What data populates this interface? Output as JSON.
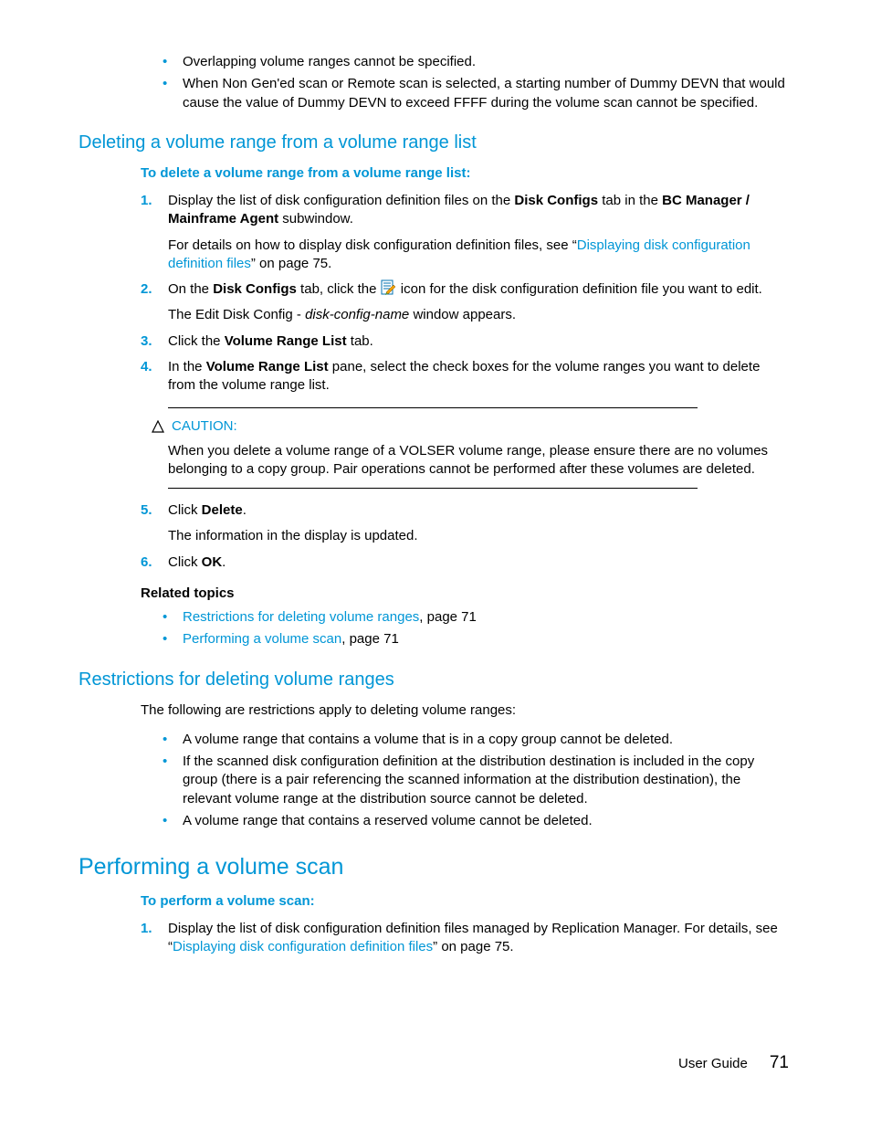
{
  "intro_bullets": [
    "Overlapping volume ranges cannot be specified.",
    "When Non Gen'ed scan or Remote scan is selected, a starting number of Dummy DEVN that would cause the value of Dummy DEVN to exceed FFFF during the volume scan cannot be specified."
  ],
  "sec1": {
    "title": "Deleting a volume range from a volume range list",
    "proc_head": "To delete a volume range from a volume range list:",
    "step1_a": "Display the list of disk configuration definition files on the ",
    "step1_b": "Disk Configs",
    "step1_c": " tab in the ",
    "step1_d": "BC Manager / Mainframe Agent",
    "step1_e": " subwindow.",
    "step1_p2a": "For details on how to display disk configuration definition files, see “",
    "step1_link": "Displaying disk configuration definition files",
    "step1_p2b": "” on page 75.",
    "step2_a": "On the ",
    "step2_b": "Disk Configs",
    "step2_c": " tab, click the ",
    "step2_d": " icon for the disk configuration definition file you want to edit.",
    "step2_p2a": "The Edit Disk Config - ",
    "step2_p2b": "disk-config-name",
    "step2_p2c": " window appears.",
    "step3_a": "Click the ",
    "step3_b": "Volume Range List",
    "step3_c": " tab.",
    "step4_a": "In the ",
    "step4_b": "Volume Range List",
    "step4_c": " pane, select the check boxes for the volume ranges you want to delete from the volume range list.",
    "caution_label": "CAUTION:",
    "caution_body": "When you delete a volume range of a VOLSER volume range, please ensure there are no volumes belonging to a copy group. Pair operations cannot be performed after these volumes are deleted.",
    "step5_a": "Click ",
    "step5_b": "Delete",
    "step5_c": ".",
    "step5_p2": "The information in the display is updated.",
    "step6_a": "Click ",
    "step6_b": "OK",
    "step6_c": ".",
    "related_head": "Related topics",
    "rel1_link": "Restrictions for deleting volume ranges",
    "rel1_suf": ", page 71",
    "rel2_link": "Performing a volume scan",
    "rel2_suf": ", page 71"
  },
  "sec2": {
    "title": "Restrictions for deleting volume ranges",
    "intro": "The following are restrictions apply to deleting volume ranges:",
    "bullets": [
      "A volume range that contains a volume that is in a copy group cannot be deleted.",
      "If the scanned disk configuration definition at the distribution destination is included in the copy group (there is a pair referencing the scanned information at the distribution destination), the relevant volume range at the distribution source cannot be deleted.",
      "A volume range that contains a reserved volume cannot be deleted."
    ]
  },
  "sec3": {
    "title": "Performing a volume scan",
    "proc_head": "To perform a volume scan:",
    "step1_a": "Display the list of disk configuration definition files managed by Replication Manager. For details, see “",
    "step1_link": "Displaying disk configuration definition files",
    "step1_b": "” on page 75."
  },
  "footer": {
    "label": "User Guide",
    "page": "71"
  }
}
